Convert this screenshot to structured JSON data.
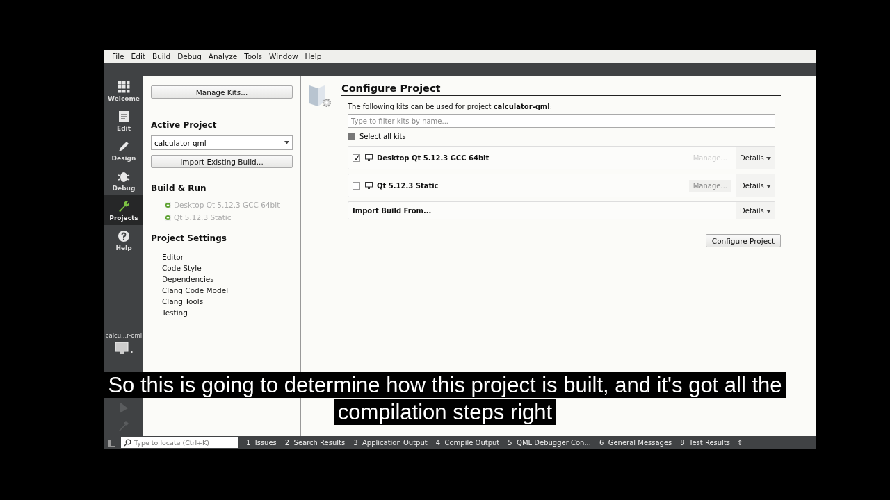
{
  "menu": [
    "File",
    "Edit",
    "Build",
    "Debug",
    "Analyze",
    "Tools",
    "Window",
    "Help"
  ],
  "modes": [
    {
      "label": "Welcome",
      "kind": "grid",
      "selected": false
    },
    {
      "label": "Edit",
      "kind": "doc",
      "selected": false
    },
    {
      "label": "Design",
      "kind": "pen",
      "selected": false
    },
    {
      "label": "Debug",
      "kind": "bug",
      "selected": false
    },
    {
      "label": "Projects",
      "kind": "wrench",
      "selected": true
    },
    {
      "label": "Help",
      "kind": "help",
      "selected": false
    }
  ],
  "target": {
    "project": "calcu...r-qml"
  },
  "nav": {
    "manage_kits": "Manage Kits...",
    "active_project_heading": "Active Project",
    "project": "calculator-qml",
    "import_button": "Import Existing Build...",
    "build_run_heading": "Build & Run",
    "kits": [
      "Desktop Qt 5.12.3 GCC 64bit",
      "Qt 5.12.3 Static"
    ],
    "settings_heading": "Project Settings",
    "settings": [
      "Editor",
      "Code Style",
      "Dependencies",
      "Clang Code Model",
      "Clang Tools",
      "Testing"
    ]
  },
  "main": {
    "title": "Configure Project",
    "intro": "The following kits can be used for project **calculator-qml**:",
    "filter": {
      "placeholder": "Type to filter kits by name..."
    },
    "select_all": {
      "label": "Select all kits",
      "partially_checked": true
    },
    "kits": [
      {
        "name": "Desktop Qt 5.12.3 GCC 64bit",
        "checked": true,
        "manage": "Manage...",
        "manage_disabled": true,
        "details": "Details"
      },
      {
        "name": "Qt 5.12.3 Static",
        "checked": false,
        "manage": "Manage...",
        "manage_disabled": false,
        "details": "Details"
      }
    ],
    "import_from": {
      "label": "Import Build From...",
      "details": "Details"
    },
    "configure_button": "Configure Project"
  },
  "status_bar": {
    "locate": {
      "placeholder": "Type to locate (Ctrl+K)"
    },
    "panes": [
      {
        "number": "1",
        "label": "Issues"
      },
      {
        "number": "2",
        "label": "Search Results"
      },
      {
        "number": "3",
        "label": "Application Output"
      },
      {
        "number": "4",
        "label": "Compile Output"
      },
      {
        "number": "5",
        "label": "QML Debugger Con..."
      },
      {
        "number": "6",
        "label": "General Messages"
      },
      {
        "number": "8",
        "label": "Test Results"
      }
    ],
    "toggle": "⇕"
  },
  "caption": [
    "So this is going to determine how this project is built, and it's got all the",
    "compilation steps right"
  ]
}
